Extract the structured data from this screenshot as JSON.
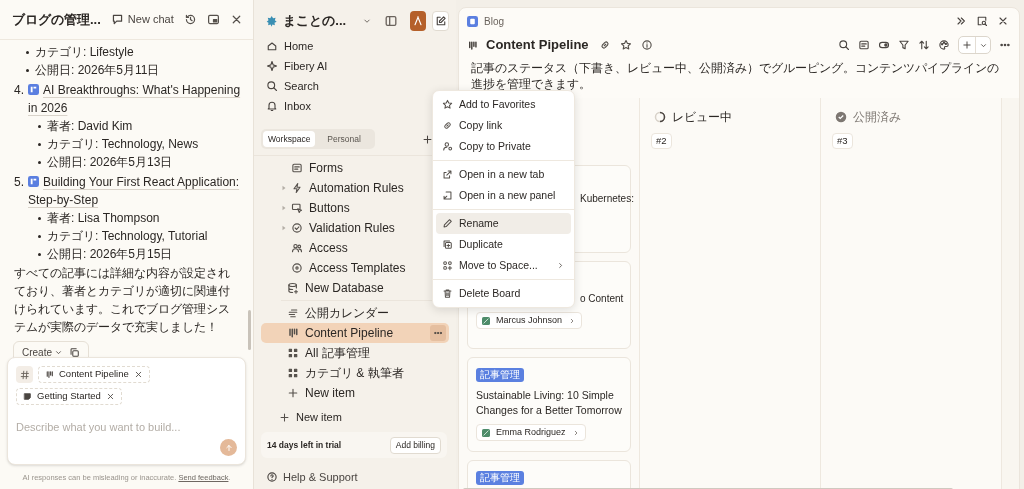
{
  "chat": {
    "title": "ブログの管理...",
    "new_chat": "New chat",
    "messages": [
      {
        "kind": "bullet",
        "text": "カテゴリ: Lifestyle"
      },
      {
        "kind": "bullet",
        "text": "公開日: 2026年5月11日"
      },
      {
        "kind": "numbered",
        "number": "4.",
        "title": "AI Breakthroughs: What's Happening in 2026",
        "children": [
          "著者: David Kim",
          "カテゴリ: Technology, News",
          "公開日: 2026年5月13日"
        ]
      },
      {
        "kind": "numbered",
        "number": "5.",
        "title": "Building Your First React Application: Step-by-Step",
        "children": [
          "著者: Lisa Thompson",
          "カテゴリ: Technology, Tutorial",
          "公開日: 2026年5月15日"
        ]
      },
      {
        "kind": "paragraph",
        "text": "すべての記事には詳細な内容が設定されており、著者とカテゴリが適切に関連付けられています。これでブログ管理システムが実際のデータで充実しました！"
      }
    ],
    "create_button": "Create",
    "context_chips": [
      {
        "label": "Content Pipeline"
      },
      {
        "label": "Getting Started"
      }
    ],
    "placeholder": "Describe what you want to build...",
    "disclaimer": "AI responses can be misleading or inaccurate.",
    "feedback_link": "Send feedback",
    "disclaimer_end": "."
  },
  "sidebar": {
    "workspace": "まことの...",
    "nav": [
      {
        "label": "Home"
      },
      {
        "label": "Fibery AI"
      },
      {
        "label": "Search"
      },
      {
        "label": "Inbox"
      }
    ],
    "tabs": [
      {
        "label": "Workspace",
        "selected": true
      },
      {
        "label": "Personal",
        "selected": false
      }
    ],
    "database_subitems": [
      {
        "label": "Forms",
        "expandable": false
      },
      {
        "label": "Automation Rules",
        "expandable": true
      },
      {
        "label": "Buttons",
        "expandable": true
      },
      {
        "label": "Validation Rules",
        "expandable": true
      },
      {
        "label": "Access",
        "expandable": false
      },
      {
        "label": "Access Templates",
        "expandable": false
      }
    ],
    "database_items": [
      {
        "label": "New Database"
      }
    ],
    "views": [
      {
        "label": "公開カレンダー",
        "selected": false
      },
      {
        "label": "Content Pipeline",
        "selected": true
      },
      {
        "label": "All 記事管理",
        "selected": false
      },
      {
        "label": "カテゴリ & 執筆者",
        "selected": false
      },
      {
        "label": "New item",
        "selected": false
      }
    ],
    "space_new_item": "New item",
    "trial": "14 days left in trial",
    "billing_button": "Add billing",
    "help": "Help & Support"
  },
  "context_menu": {
    "groups": [
      [
        {
          "label": "Add to Favorites",
          "highlighted": false,
          "submenu": false
        },
        {
          "label": "Copy link",
          "highlighted": false,
          "submenu": false
        },
        {
          "label": "Copy to Private",
          "highlighted": false,
          "submenu": false
        }
      ],
      [
        {
          "label": "Open in a new tab",
          "highlighted": false,
          "submenu": false
        },
        {
          "label": "Open in a new panel",
          "highlighted": false,
          "submenu": false
        }
      ],
      [
        {
          "label": "Rename",
          "highlighted": true,
          "submenu": false
        },
        {
          "label": "Duplicate",
          "highlighted": false,
          "submenu": false
        },
        {
          "label": "Move to Space...",
          "highlighted": false,
          "submenu": true
        }
      ],
      [
        {
          "label": "Delete Board",
          "highlighted": false,
          "submenu": false
        }
      ]
    ]
  },
  "main": {
    "breadcrumb": "Blog",
    "title": "Content Pipeline",
    "description": "記事のステータス（下書き、レビュー中、公開済み）でグルーピング。コンテンツパイプラインの進捗を管理できます。",
    "columns": [
      {
        "cards": [
          {
            "kind": "covered",
            "title": "Kubernetes:"
          },
          {
            "kind": "covered",
            "title": "o Content",
            "author": "Marcus Johnson"
          },
          {
            "kind": "full",
            "tag": "記事管理",
            "title": "Sustainable Living: 10 Simple Changes for a Better Tomorrow",
            "author": "Emma Rodriguez"
          },
          {
            "kind": "full",
            "tag": "記事管理"
          }
        ]
      },
      {
        "kind": "in_progress",
        "title": "レビュー中",
        "count": "#2"
      },
      {
        "kind": "done",
        "title": "公開済み",
        "count": "#3"
      }
    ]
  }
}
